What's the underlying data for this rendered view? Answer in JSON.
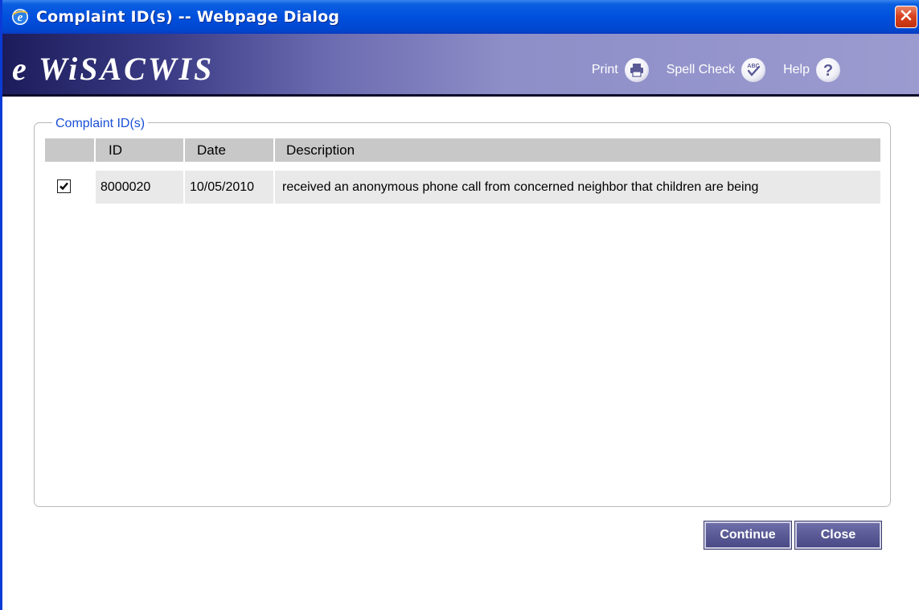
{
  "window": {
    "title": "Complaint ID(s) -- Webpage Dialog"
  },
  "banner": {
    "brand": "e WiSACWIS",
    "tools": {
      "print": "Print",
      "spell_check": "Spell Check",
      "help": "Help"
    }
  },
  "group": {
    "legend": "Complaint ID(s)"
  },
  "table": {
    "headers": {
      "select": "",
      "id": "ID",
      "date": "Date",
      "description": "Description"
    },
    "rows": [
      {
        "checked": true,
        "id": "8000020",
        "date": "10/05/2010",
        "description": "received an anonymous phone call from concerned neighbor that children are being"
      }
    ]
  },
  "buttons": {
    "continue": "Continue",
    "close": "Close"
  },
  "icons": {
    "window_icon": "internet-explorer-icon",
    "close": "close-icon",
    "print": "printer-icon",
    "spell_check": "spell-check-icon",
    "help": "help-icon",
    "checkbox": "checkmark-icon"
  },
  "colors": {
    "titlebar": "#0050de",
    "banner_dark": "#1c1c5c",
    "banner_light": "#9b9bd0",
    "legend_text": "#1a4fd6",
    "button": "#5a5a96",
    "header_bg": "#c8c8c8",
    "row_bg": "#e9e9e9"
  }
}
